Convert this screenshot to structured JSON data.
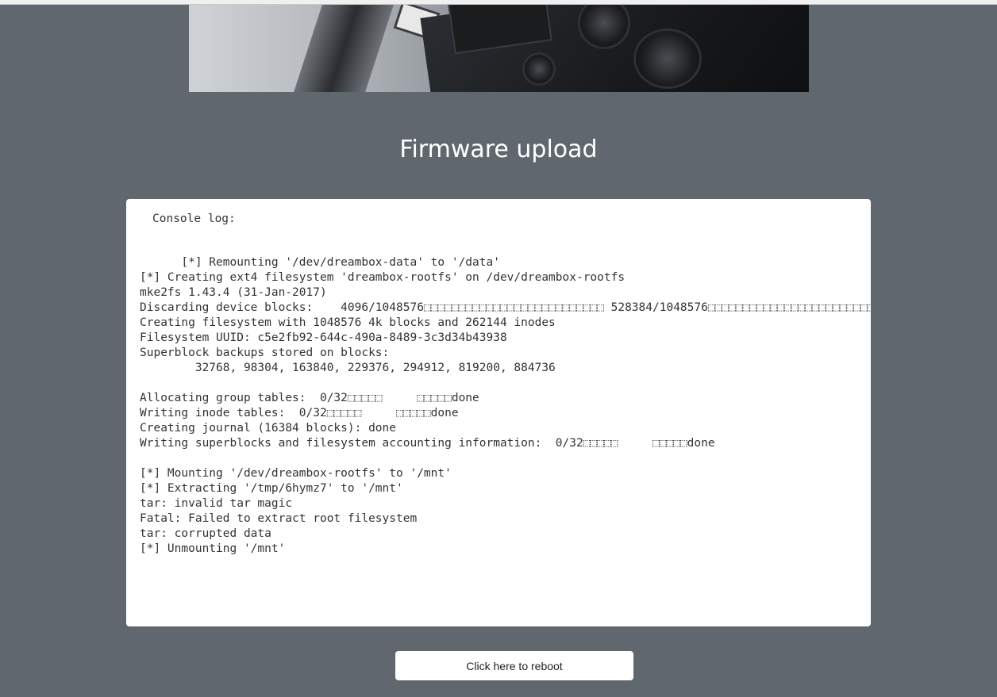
{
  "page": {
    "title": "Firmware upload"
  },
  "console": {
    "label": "Console log:",
    "lines": [
      "      [*] Remounting '/dev/dreambox-data' to '/data'",
      "[*] Creating ext4 filesystem 'dreambox-rootfs' on /dev/dreambox-rootfs",
      "mke2fs 1.43.4 (31-Jan-2017)",
      "Discarding device blocks:    4096/1048576\b\b\b\b\b\b\b\b\b\b\b\b\b\b\b\b\b\b\b\b\b\b\b\b\b\b 528384/1048576\b\b\b\b\b\b\b\b\b\b\b\b\b\b\b\b\b\b\b\b\b\b\b\b\b\b\b                \b\b",
      "Creating filesystem with 1048576 4k blocks and 262144 inodes",
      "Filesystem UUID: c5e2fb92-644c-490a-8489-3c3d34b43938",
      "Superblock backups stored on blocks: ",
      "        32768, 98304, 163840, 229376, 294912, 819200, 884736",
      "",
      "Allocating group tables:  0/32\b\b\b\b\b     \b\b\b\b\bdone",
      "Writing inode tables:  0/32\b\b\b\b\b     \b\b\b\b\bdone",
      "Creating journal (16384 blocks): done",
      "Writing superblocks and filesystem accounting information:  0/32\b\b\b\b\b     \b\b\b\b\bdone",
      "",
      "[*] Mounting '/dev/dreambox-rootfs' to '/mnt'",
      "[*] Extracting '/tmp/6hymz7' to '/mnt'",
      "tar: invalid tar magic",
      "Fatal: Failed to extract root filesystem",
      "tar: corrupted data",
      "[*] Unmounting '/mnt'"
    ]
  },
  "actions": {
    "reboot_label": "Click here to reboot"
  }
}
